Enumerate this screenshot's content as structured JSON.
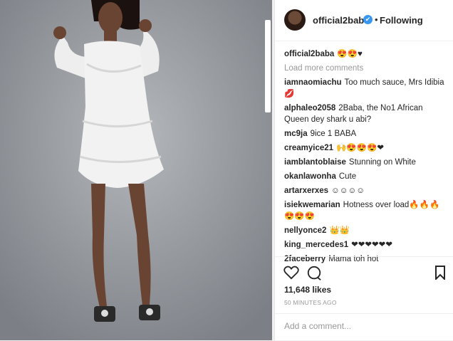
{
  "post": {
    "username": "official2baba",
    "verified_mark": "✔",
    "separator": "•",
    "follow_status": "Following"
  },
  "caption": {
    "user": "official2baba",
    "text": "😍😍♥"
  },
  "load_more": "Load more comments",
  "comments": [
    {
      "user": "iamnaomiachu",
      "text": "Too much sauce, Mrs Idibia 💋"
    },
    {
      "user": "alphaleo2058",
      "text": "2Baba, the No1 African Queen dey shark u abi?"
    },
    {
      "user": "mc9ja",
      "text": "9ice 1 BABA"
    },
    {
      "user": "creamyice21",
      "text": "🙌😍😍😍❤"
    },
    {
      "user": "iamblantoblaise",
      "text": "Stunning on White"
    },
    {
      "user": "okanlawonha",
      "text": "Cute"
    },
    {
      "user": "artarxerxes",
      "text": "☺☺☺☺"
    },
    {
      "user": "isiekwemarian",
      "text": "Hotness over load🔥🔥🔥 😍😍😍"
    },
    {
      "user": "nellyonce2",
      "text": "👑👑"
    },
    {
      "user": "king_mercedes1",
      "text": "❤❤❤❤❤❤"
    },
    {
      "user": "2faceberry",
      "text": "Mama toh hot"
    }
  ],
  "likes": "11,648 likes",
  "timestamp": "50 MINUTES AGO",
  "add_comment_placeholder": "Add a comment...",
  "icons": [
    "heart-icon",
    "comment-icon",
    "bookmark-icon",
    "verified-icon"
  ],
  "colors": {
    "link": "#3897f0",
    "text": "#262626",
    "muted": "#999999",
    "heart": "#ed4956"
  }
}
